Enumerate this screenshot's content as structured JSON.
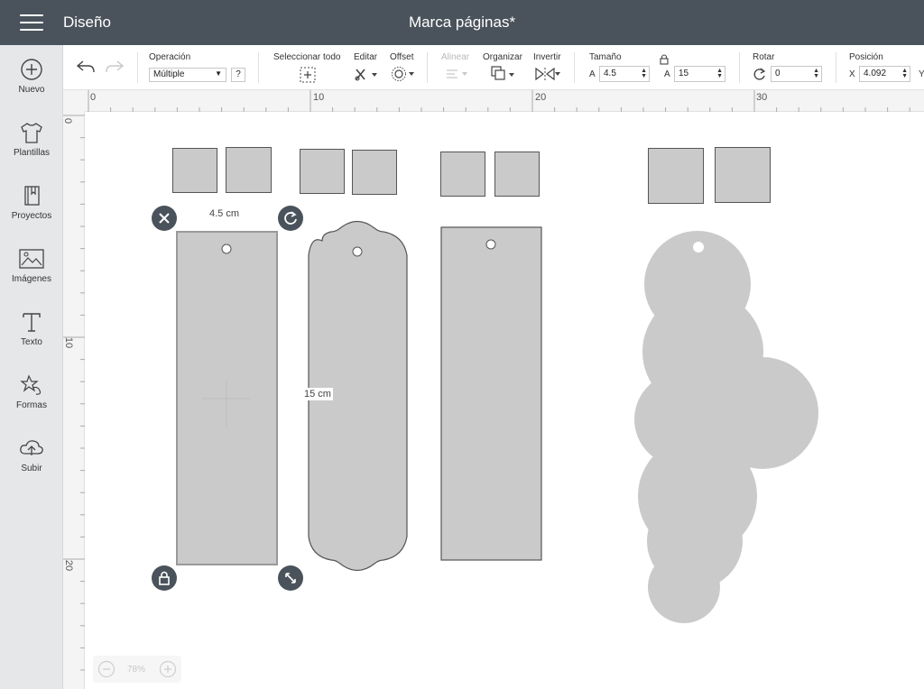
{
  "header": {
    "app_name": "Diseño",
    "doc_title": "Marca páginas*"
  },
  "sidebar": {
    "items": [
      {
        "label": "Nuevo",
        "icon": "plus-circle-icon"
      },
      {
        "label": "Plantillas",
        "icon": "tshirt-icon"
      },
      {
        "label": "Proyectos",
        "icon": "book-icon"
      },
      {
        "label": "Imágenes",
        "icon": "image-icon"
      },
      {
        "label": "Texto",
        "icon": "text-icon"
      },
      {
        "label": "Formas",
        "icon": "shapes-icon"
      },
      {
        "label": "Subir",
        "icon": "upload-cloud-icon"
      }
    ]
  },
  "toolbar": {
    "operation_label": "Operación",
    "operation_value": "Múltiple",
    "help": "?",
    "select_all_label": "Seleccionar todo",
    "edit_label": "Editar",
    "offset_label": "Offset",
    "align_label": "Alinear",
    "organize_label": "Organizar",
    "invert_label": "Invertir",
    "size_label": "Tamaño",
    "width_letter": "A",
    "width_value": "4.5",
    "height_letter": "A",
    "height_value": "15",
    "rotate_label": "Rotar",
    "rotate_value": "0",
    "position_label": "Posición",
    "pos_x_letter": "X",
    "pos_x_value": "4.092",
    "pos_y_letter": "Y"
  },
  "ruler": {
    "top": [
      "0",
      "10",
      "20",
      "30"
    ],
    "left": [
      "0",
      "10",
      "20"
    ]
  },
  "canvas": {
    "width_label": "4.5 cm",
    "height_label": "15 cm"
  },
  "zoom": {
    "value": "78%"
  },
  "colors": {
    "topbar": "#4a535b",
    "shape_fill": "#cacaca",
    "sidebar": "#e6e7e8"
  }
}
